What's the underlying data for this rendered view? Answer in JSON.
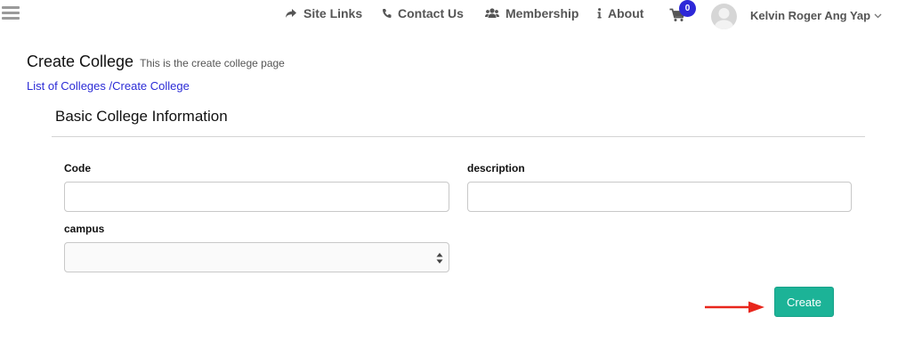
{
  "nav": {
    "site_links": "Site Links",
    "contact_us": "Contact Us",
    "membership": "Membership",
    "about": "About",
    "cart_count": "0",
    "user_name": "Kelvin Roger Ang Yap"
  },
  "header": {
    "title": "Create College",
    "subtitle": "This is the create college page",
    "breadcrumb": {
      "parent": "List of Colleges",
      "separator": "/",
      "current": "Create College"
    }
  },
  "form": {
    "section_title": "Basic College Information",
    "code_label": "Code",
    "code_value": "",
    "description_label": "description",
    "description_value": "",
    "campus_label": "campus",
    "campus_value": "",
    "submit_label": "Create"
  },
  "colors": {
    "accent": "#1cb397",
    "badge": "#2d28d8",
    "link": "#2b2bd6",
    "annotation_arrow": "#e8261c"
  },
  "icons": [
    "menu-icon",
    "share-icon",
    "phone-icon",
    "users-icon",
    "info-icon",
    "cart-icon",
    "avatar-icon",
    "chevron-down-icon",
    "select-arrows-icon",
    "annotation-arrow-icon"
  ]
}
